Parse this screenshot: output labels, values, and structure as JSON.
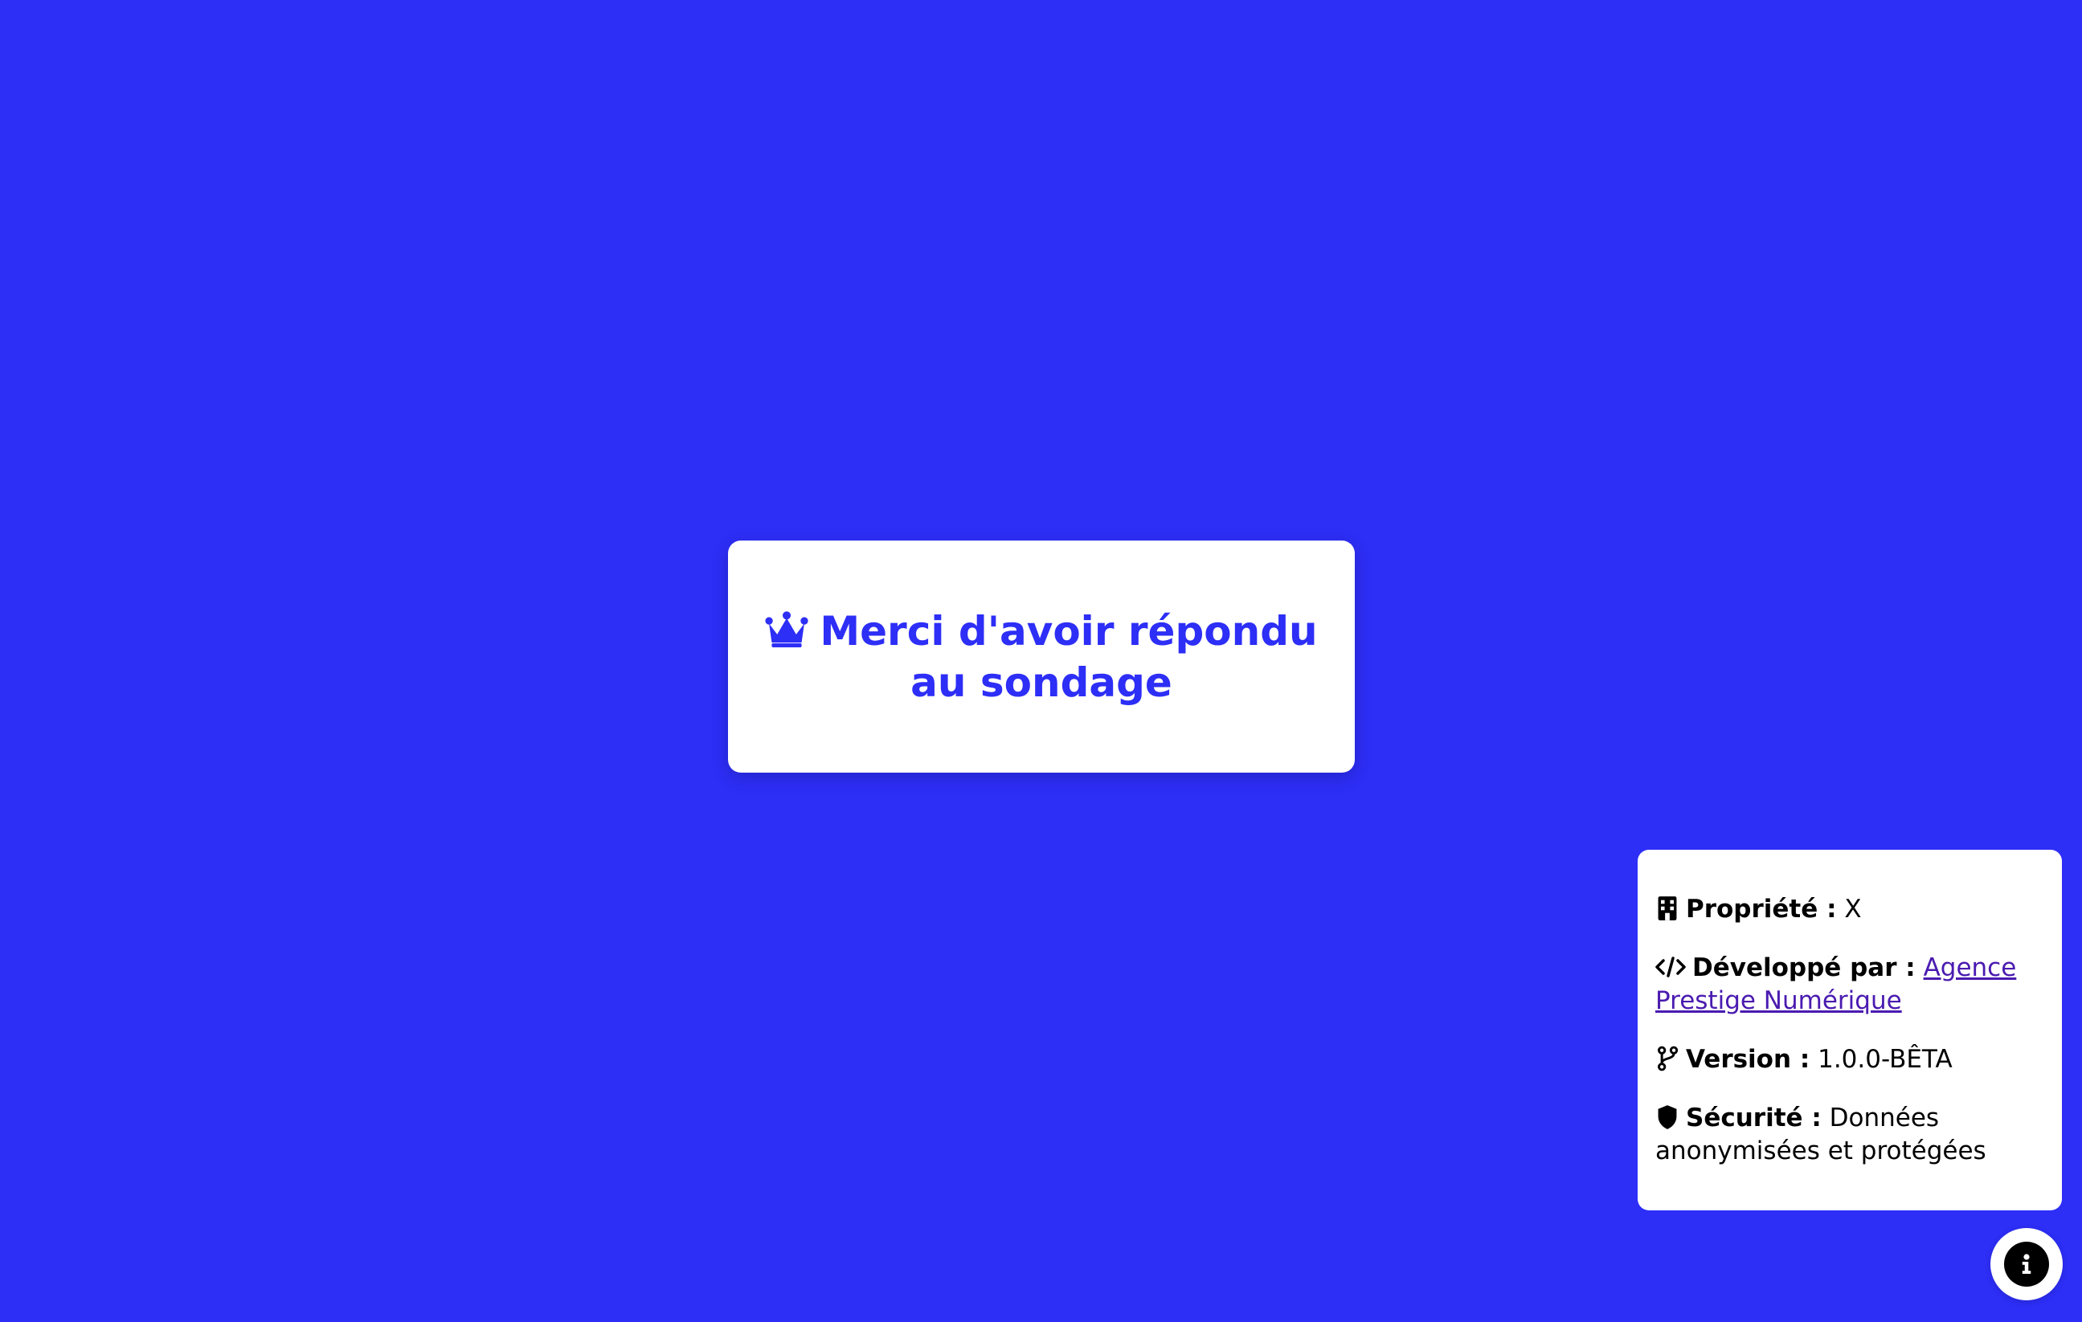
{
  "thanks_card": {
    "icon": "crown-icon",
    "title": "Merci d'avoir répondu au sondage"
  },
  "info_panel": {
    "rows": [
      {
        "icon": "building-icon",
        "label": "Propriété :",
        "value": "X"
      },
      {
        "icon": "code-icon",
        "label": "Développé par :",
        "value": "Agence Prestige Numérique",
        "is_link": true
      },
      {
        "icon": "git-branch-icon",
        "label": "Version :",
        "value": "1.0.0-BÊTA"
      },
      {
        "icon": "shield-icon",
        "label": "Sécurité :",
        "value": "Données anonymisées et protégées"
      }
    ]
  },
  "info_toggle": {
    "icon": "info-icon"
  },
  "colors": {
    "background": "#2d2ef6",
    "card": "#ffffff",
    "title": "#2d2ef6",
    "link": "#4a1bb0"
  }
}
